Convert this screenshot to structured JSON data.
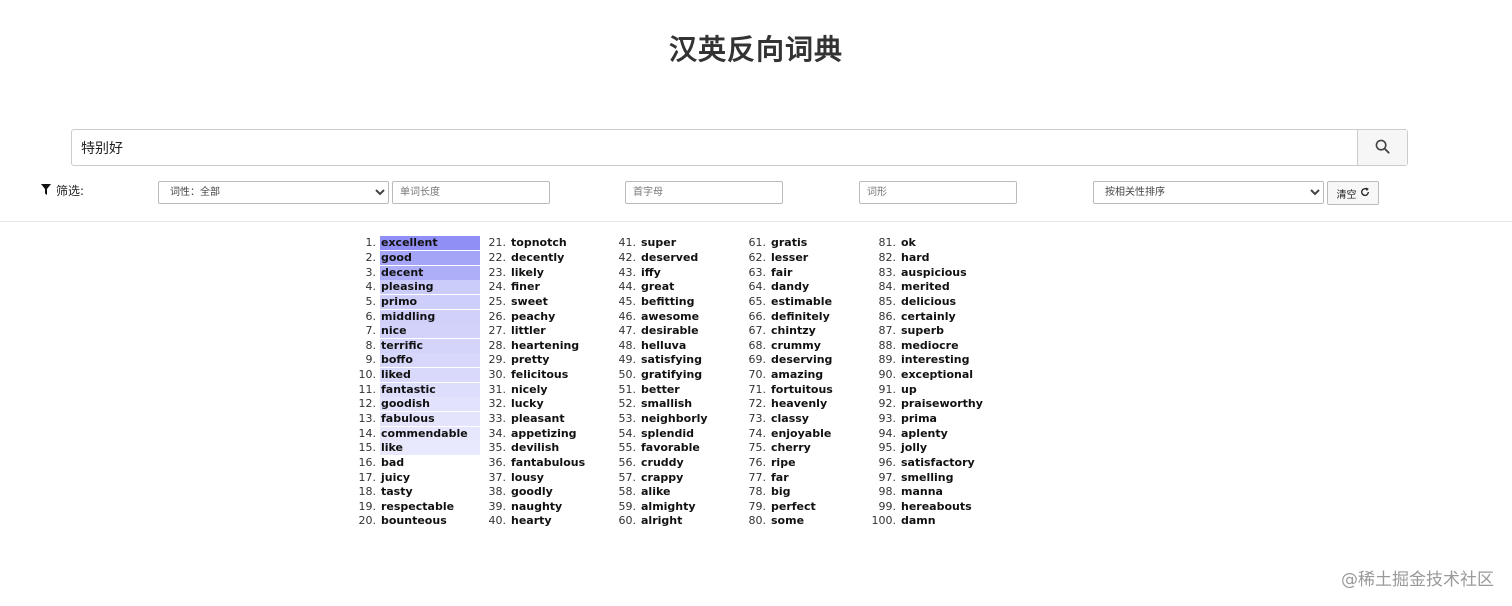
{
  "title": "汉英反向词典",
  "search": {
    "value": "特别好",
    "button_icon": "search-icon"
  },
  "filters": {
    "label": "筛选:",
    "pos_select": "词性：全部",
    "length_placeholder": "单词长度",
    "initial_placeholder": "首字母",
    "form_placeholder": "词形",
    "sort_select": "按相关性排序",
    "clear_label": "清空"
  },
  "results": [
    "excellent",
    "good",
    "decent",
    "pleasing",
    "primo",
    "middling",
    "nice",
    "terrific",
    "boffo",
    "liked",
    "fantastic",
    "goodish",
    "fabulous",
    "commendable",
    "like",
    "bad",
    "juicy",
    "tasty",
    "respectable",
    "bounteous",
    "topnotch",
    "decently",
    "likely",
    "finer",
    "sweet",
    "peachy",
    "littler",
    "heartening",
    "pretty",
    "felicitous",
    "nicely",
    "lucky",
    "pleasant",
    "appetizing",
    "devilish",
    "fantabulous",
    "lousy",
    "goodly",
    "naughty",
    "hearty",
    "super",
    "deserved",
    "iffy",
    "great",
    "befitting",
    "awesome",
    "desirable",
    "helluva",
    "satisfying",
    "gratifying",
    "better",
    "smallish",
    "neighborly",
    "splendid",
    "favorable",
    "cruddy",
    "crappy",
    "alike",
    "almighty",
    "alright",
    "gratis",
    "lesser",
    "fair",
    "dandy",
    "estimable",
    "definitely",
    "chintzy",
    "crummy",
    "deserving",
    "amazing",
    "fortuitous",
    "heavenly",
    "classy",
    "enjoyable",
    "cherry",
    "ripe",
    "far",
    "big",
    "perfect",
    "some",
    "ok",
    "hard",
    "auspicious",
    "merited",
    "delicious",
    "certainly",
    "superb",
    "mediocre",
    "interesting",
    "exceptional",
    "up",
    "praiseworthy",
    "prima",
    "aplenty",
    "jolly",
    "satisfactory",
    "smelling",
    "manna",
    "hereabouts",
    "damn"
  ],
  "highlight": {
    "color": "#8f8ff5",
    "relevance": [
      1.0,
      0.8,
      0.72,
      0.46,
      0.44,
      0.42,
      0.4,
      0.38,
      0.36,
      0.34,
      0.3,
      0.26,
      0.24,
      0.22,
      0.2
    ]
  },
  "watermark": "@稀土掘金技术社区"
}
